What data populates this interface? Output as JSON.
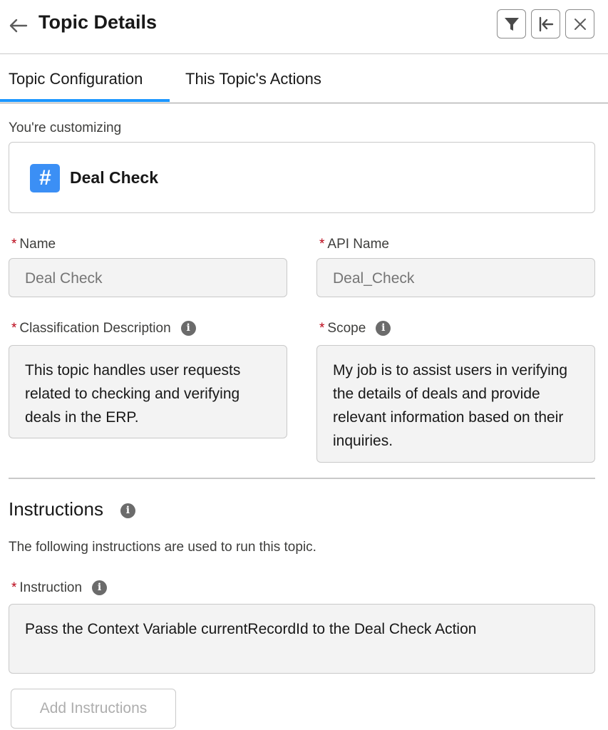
{
  "header": {
    "title": "Topic Details",
    "back_icon": "arrow-left-icon",
    "buttons": [
      "filter-icon",
      "collapse-left-icon",
      "close-icon"
    ]
  },
  "tabs": [
    {
      "label": "Topic Configuration",
      "active": true
    },
    {
      "label": "This Topic's Actions",
      "active": false
    }
  ],
  "customizing": {
    "label": "You're customizing",
    "topic_icon": "#",
    "topic_name": "Deal Check"
  },
  "fields": {
    "name": {
      "label": "Name",
      "value": "Deal Check",
      "required": "*"
    },
    "api_name": {
      "label": "API Name",
      "value": "Deal_Check",
      "required": "*"
    },
    "classification": {
      "label": "Classification Description",
      "required": "*",
      "info": "i",
      "value": "This topic handles user requests related to checking and verifying deals in the ERP."
    },
    "scope": {
      "label": "Scope",
      "required": "*",
      "info": "i",
      "value": "My job is to assist users in verifying the details of deals and provide relevant information based on their inquiries."
    }
  },
  "instructions": {
    "title": "Instructions",
    "info": "i",
    "description": "The following instructions are used to run this topic.",
    "instruction_label": "Instruction",
    "required": "*",
    "instruction_value": "Pass the Context Variable currentRecordId to the Deal Check Action",
    "add_button": "Add Instructions"
  },
  "colors": {
    "accent": "#1b96ff",
    "required": "#ba0517",
    "topic_icon_bg": "#3b8ff5"
  }
}
